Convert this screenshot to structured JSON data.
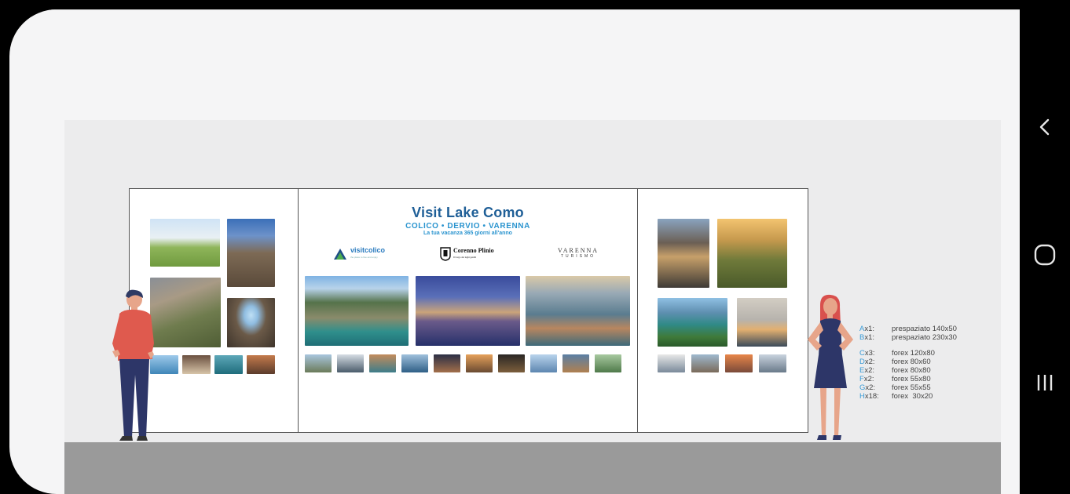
{
  "poster": {
    "title": "Visit Lake Como",
    "subtitle": "COLICO • DERVIO • VARENNA",
    "tagline": "La tua vacanza 365 giorni all'anno"
  },
  "logos": {
    "colico_main": "visitcolico",
    "colico_sub": "the place to live and enjoy",
    "corenno_main": "Corenno Plinio",
    "corenno_sub": "Il borgo dei laghi gentili",
    "varenna_top": "VARENNA",
    "varenna_bottom": "TURISMO"
  },
  "legend": [
    {
      "letter": "A",
      "rest": "x1:",
      "desc": "prespaziato 140x50"
    },
    {
      "letter": "B",
      "rest": "x1:",
      "desc": "prespaziato 230x30"
    },
    {
      "letter": "C",
      "rest": "x3:",
      "desc": "forex 120x80"
    },
    {
      "letter": "D",
      "rest": "x2:",
      "desc": "forex 80x60"
    },
    {
      "letter": "E",
      "rest": "x2:",
      "desc": "forex 80x80"
    },
    {
      "letter": "F",
      "rest": "x2:",
      "desc": "forex 55x80"
    },
    {
      "letter": "G",
      "rest": "x2:",
      "desc": "forex 55x55"
    },
    {
      "letter": "H",
      "rest": "x18:",
      "desc": "forex  30x20"
    }
  ],
  "nav": {
    "back_icon": "chevron-left-icon",
    "home_icon": "circle-home-icon",
    "recents_icon": "three-bars-recents-icon"
  },
  "colors": {
    "title": "#1f5f97",
    "subtitle": "#2a94cf",
    "legend_letter": "#3a9bd6",
    "floor": "#9a9a9a",
    "wall": "#ececed"
  }
}
